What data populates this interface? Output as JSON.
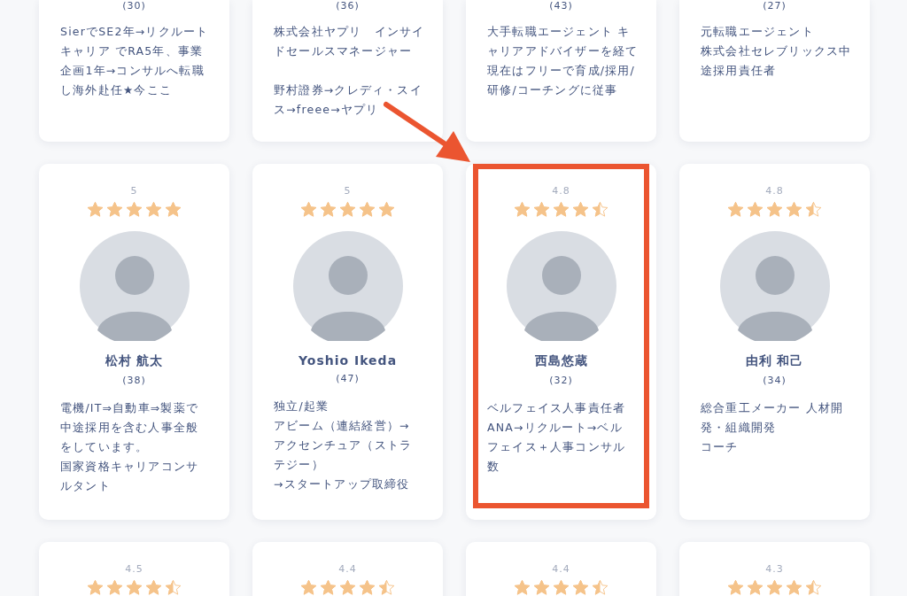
{
  "rows": [
    {
      "cards": [
        {
          "age": "(30)",
          "bio": [
            "SierでSE2年→リクルートキャリア でRA5年、事業企画1年→コンサルへ転職し海外赴任★今ここ"
          ]
        },
        {
          "age": "(36)",
          "bio": [
            "株式会社ヤプリ　インサイドセールスマネージャー",
            "野村證券→クレディ・スイス→freee→ヤプリ"
          ]
        },
        {
          "age": "(43)",
          "bio": [
            "大手転職エージェント キャリアアドバイザーを経て",
            "現在はフリーで育成/採用/研修/コーチングに従事"
          ]
        },
        {
          "age": "(27)",
          "bio": [
            "元転職エージェント",
            "株式会社セレブリックス中途採用責任者"
          ]
        }
      ]
    },
    {
      "cards": [
        {
          "rating": "5",
          "stars": 5,
          "name": "松村 航太",
          "age": "(38)",
          "bio": [
            "電機/IT⇒自動車⇒製薬で中途採用を含む人事全般をしています。",
            "国家資格キャリアコンサルタント"
          ],
          "highlighted": false
        },
        {
          "rating": "5",
          "stars": 5,
          "name": "Yoshio Ikeda",
          "age": "(47)",
          "bio": [
            "独立/起業",
            "アビーム（連結経営）→アクセンチュア（ストラテジー）",
            "→スタートアップ取締役"
          ],
          "highlighted": false
        },
        {
          "rating": "4.8",
          "stars": 4.5,
          "name": "西島悠蔵",
          "age": "(32)",
          "bio": [
            "ベルフェイス人事責任者",
            "ANA→リクルート→ベルフェイス＋人事コンサル数"
          ],
          "highlighted": true
        },
        {
          "rating": "4.8",
          "stars": 4.5,
          "name": "由利 和己",
          "age": "(34)",
          "bio": [
            "総合重工メーカー 人材開発・組織開発",
            "コーチ"
          ],
          "highlighted": false
        }
      ]
    },
    {
      "cards": [
        {
          "rating": "4.5",
          "stars": 4.5
        },
        {
          "rating": "4.4",
          "stars": 4.5
        },
        {
          "rating": "4.4",
          "stars": 4.5
        },
        {
          "rating": "4.3",
          "stars": 4.5
        }
      ]
    }
  ]
}
